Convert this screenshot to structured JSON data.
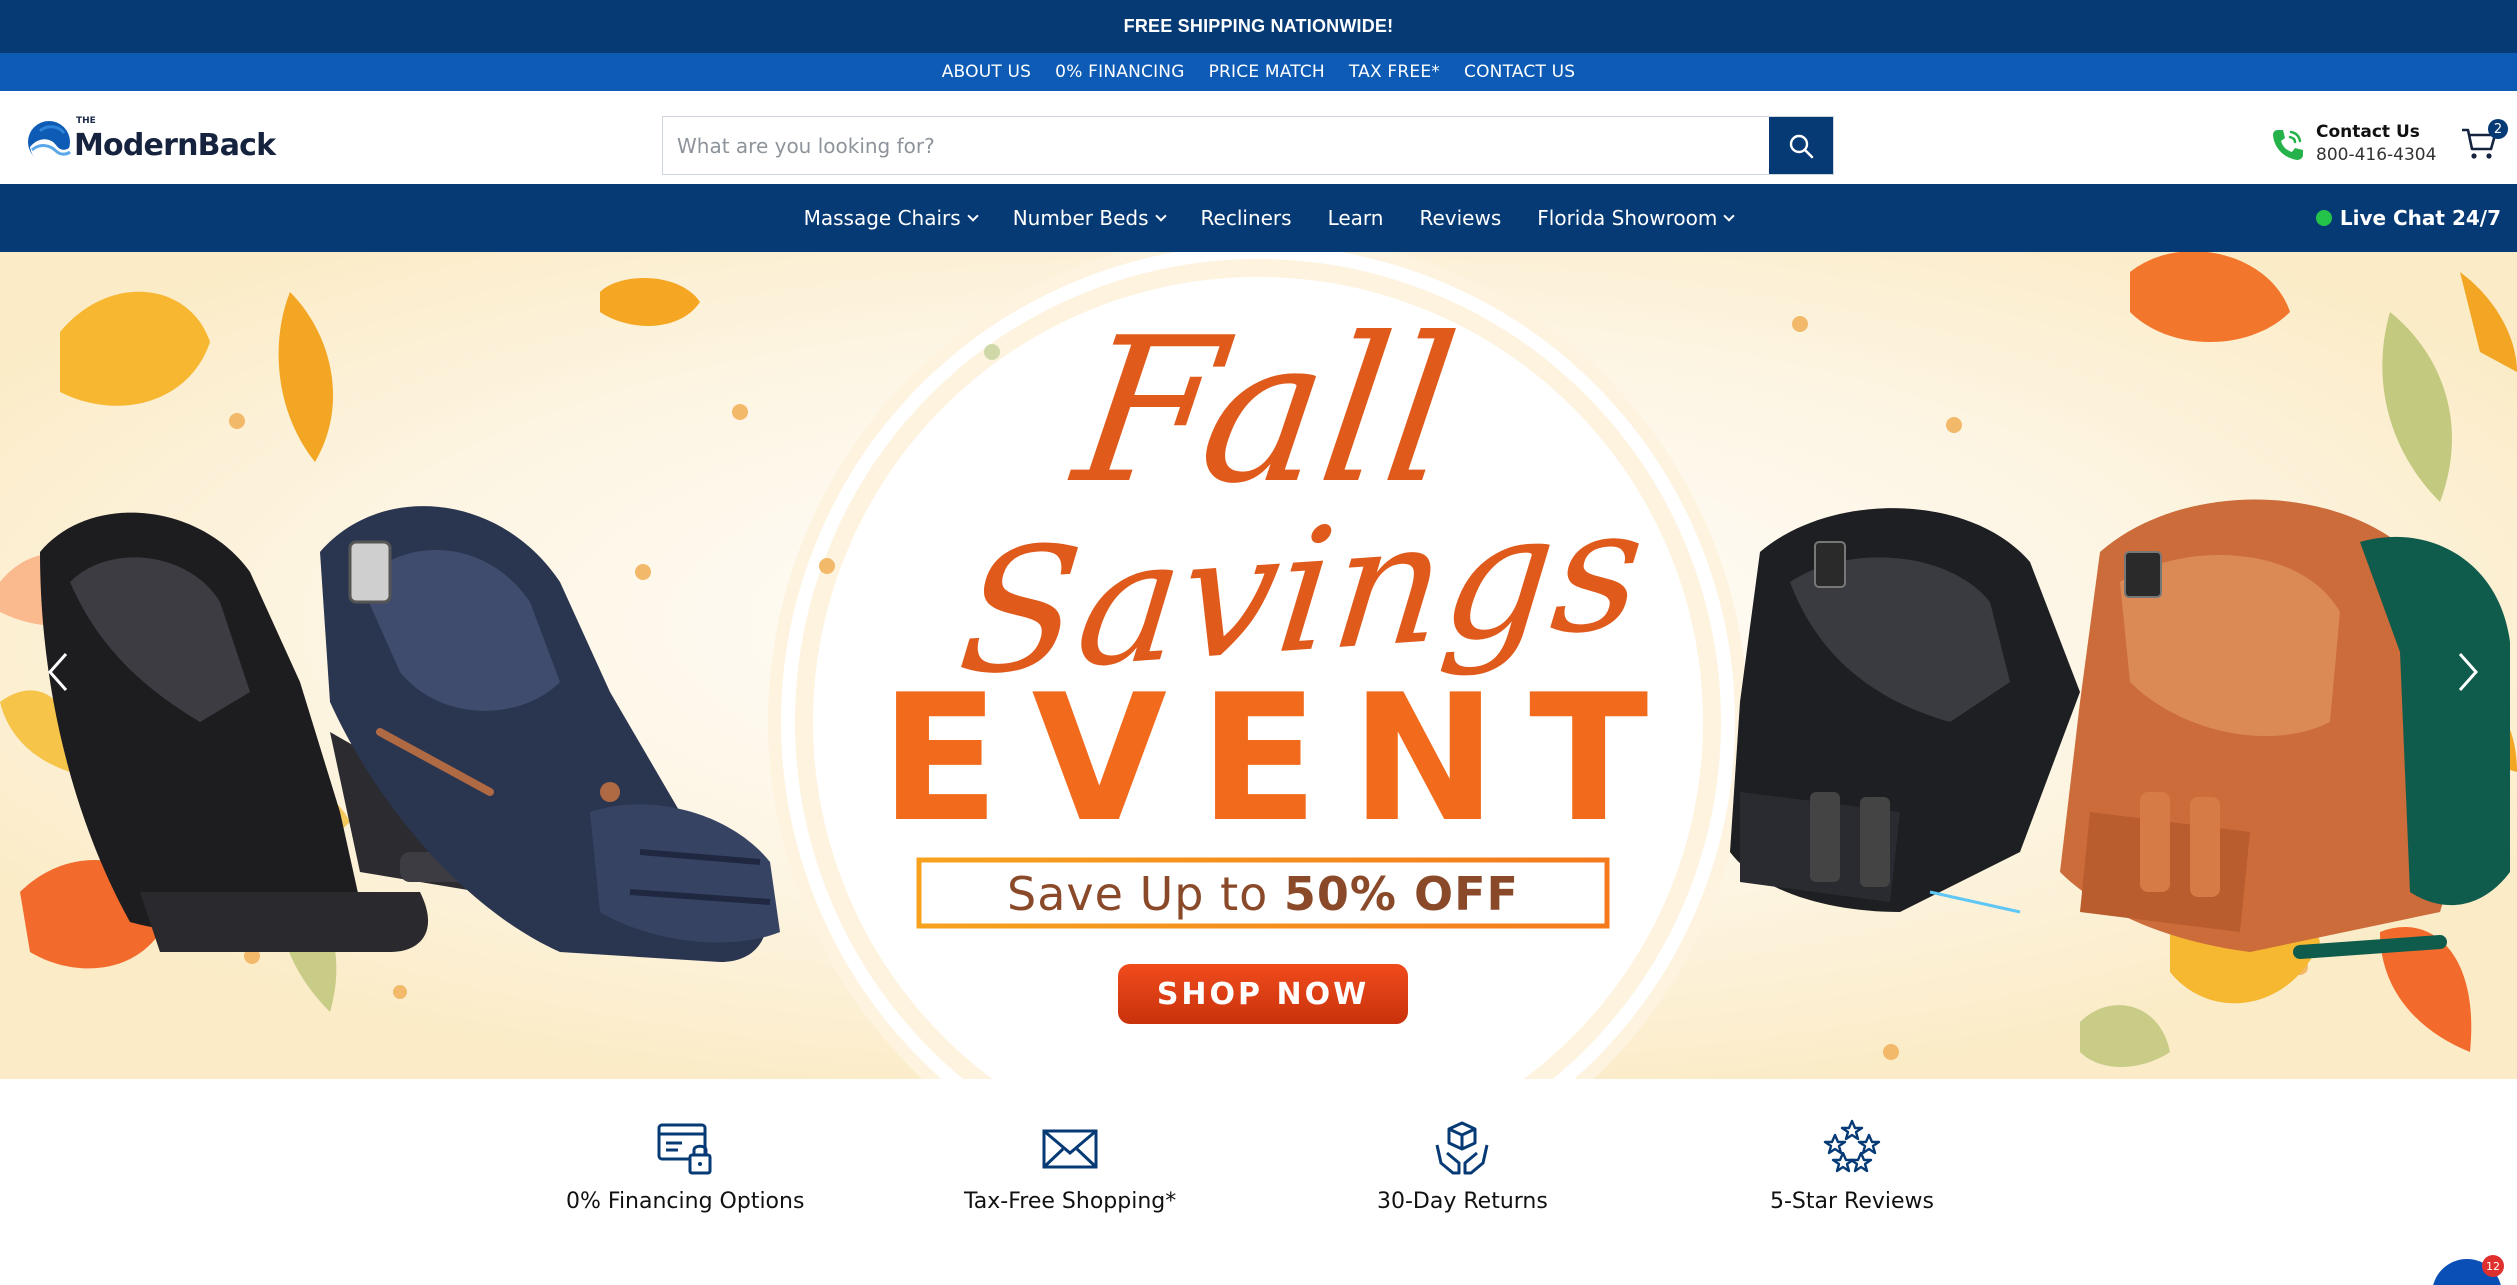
{
  "announcement": "FREE SHIPPING NATIONWIDE!",
  "links": [
    "ABOUT US",
    "0% FINANCING",
    "PRICE MATCH",
    "TAX FREE*",
    "CONTACT US"
  ],
  "logo": {
    "the": "THE",
    "name": "ModernBack"
  },
  "search": {
    "placeholder": "What are you looking for?"
  },
  "contact": {
    "title": "Contact Us",
    "phone": "800-416-4304"
  },
  "cart": {
    "count": "2"
  },
  "nav": {
    "items": [
      {
        "label": "Massage Chairs",
        "dropdown": true
      },
      {
        "label": "Number Beds",
        "dropdown": true
      },
      {
        "label": "Recliners",
        "dropdown": false
      },
      {
        "label": "Learn",
        "dropdown": false
      },
      {
        "label": "Reviews",
        "dropdown": false
      },
      {
        "label": "Florida Showroom",
        "dropdown": true
      }
    ],
    "livechat": "Live Chat 24/7"
  },
  "hero": {
    "script_line1": "Fall",
    "script_line2": "Savings",
    "headline": "EVENT",
    "save_prefix": "Save Up to ",
    "save_bold": "50% OFF",
    "cta": "SHOP NOW"
  },
  "features": [
    {
      "label": "0% Financing Options",
      "icon": "card-lock-icon"
    },
    {
      "label": "Tax-Free Shopping*",
      "icon": "envelope-icon"
    },
    {
      "label": "30-Day Returns",
      "icon": "hands-box-icon"
    },
    {
      "label": "5-Star Reviews",
      "icon": "stars-icon"
    }
  ],
  "colors": {
    "navy": "#063a75",
    "blue": "#0d5bb5",
    "orange": "#f26b1d",
    "hero_bg": "#fcf1d7",
    "green": "#24c44b"
  },
  "chat_badge": "12"
}
